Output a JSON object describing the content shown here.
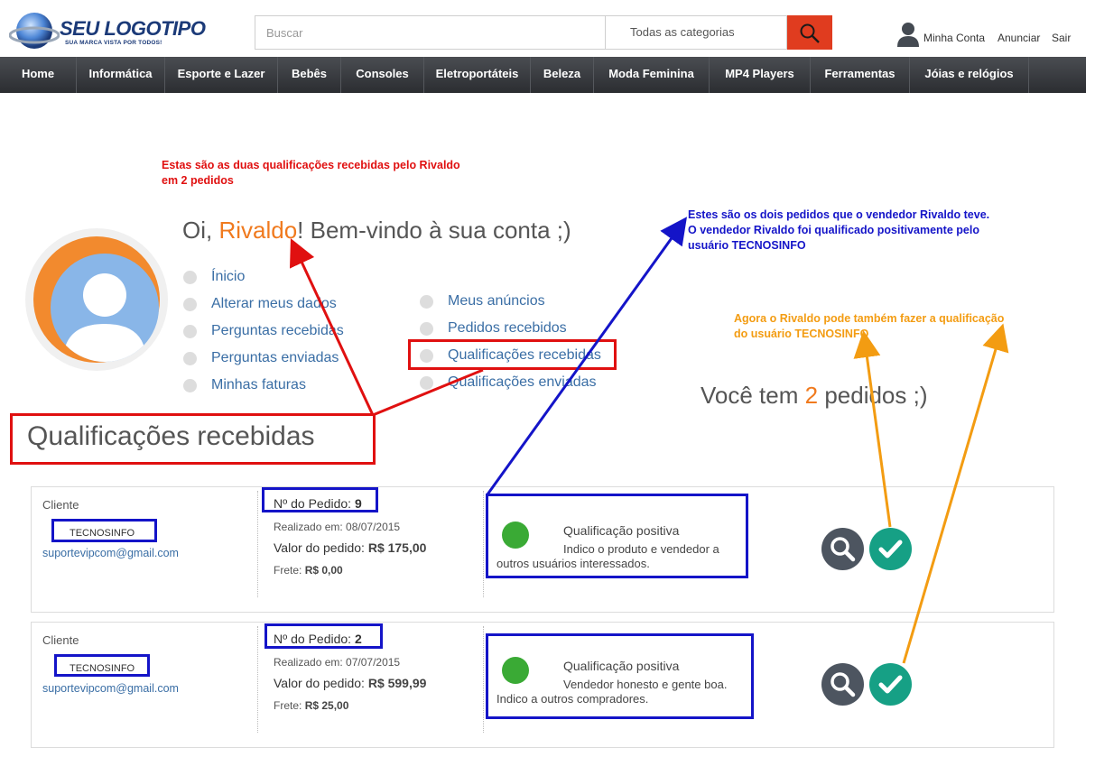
{
  "header": {
    "logo_title": "SEU LOGOTIPO",
    "logo_subtitle": "SUA MARCA VISTA POR TODOS!",
    "search_placeholder": "Buscar",
    "category_label": "Todas as categorias",
    "account_label": "Minha Conta",
    "announce_label": "Anunciar",
    "logout_label": "Sair"
  },
  "nav": [
    "Home",
    "Informática",
    "Esporte e Lazer",
    "Bebês",
    "Consoles",
    "Eletroportáteis",
    "Beleza",
    "Moda Feminina",
    "MP4 Players",
    "Ferramentas",
    "Jóias e relógios"
  ],
  "annotations": {
    "red_line1": "Estas são as duas qualificações recebidas pelo Rivaldo",
    "red_line2": "em 2 pedidos",
    "blue_line1": "Estes são os dois pedidos que o vendedor Rivaldo teve.",
    "blue_line2": "O vendedor Rivaldo foi qualificado positivamente pelo",
    "blue_line3": "usuário TECNOSINFO",
    "orange_line1": "Agora o Rivaldo pode também fazer a qualificação",
    "orange_line2": "do usuário TECNOSINFO"
  },
  "greeting": {
    "prefix": "Oi, ",
    "name": "Rivaldo",
    "suffix": "! Bem-vindo à sua conta ;)"
  },
  "menu_left": [
    "Ínicio",
    "Alterar meus dados",
    "Perguntas recebidas",
    "Perguntas enviadas",
    "Minhas faturas"
  ],
  "menu_right": [
    "Meus anúncios",
    "Pedidos recebidos",
    "Qualificações recebidas",
    "Qualificações enviadas"
  ],
  "orders_summary": {
    "prefix": "Você tem ",
    "count": "2",
    "suffix": " pedidos ;)"
  },
  "section_title": "Qualificações recebidas",
  "orders": [
    {
      "client_label": "Cliente",
      "username": "TECNOSINFO",
      "email": "suportevipcom@gmail.com",
      "order_label": "Nº do Pedido: ",
      "order_number": "9",
      "date_text": "Realizado em: 08/07/2015",
      "value_label": "Valor do pedido: ",
      "value": "R$ 175,00",
      "shipping_label": "Frete: ",
      "shipping": "R$ 0,00",
      "rating_title": "Qualificação positiva",
      "rating_text": "Indico o produto e vendedor a outros usuários interessados."
    },
    {
      "client_label": "Cliente",
      "username": "TECNOSINFO",
      "email": "suportevipcom@gmail.com",
      "order_label": "Nº do Pedido: ",
      "order_number": "2",
      "date_text": "Realizado em: 07/07/2015",
      "value_label": "Valor do pedido: ",
      "value": "R$ 599,99",
      "shipping_label": "Frete: ",
      "shipping": "R$ 25,00",
      "rating_title": "Qualificação positiva",
      "rating_text": "Vendedor honesto e gente boa. Indico a outros compradores."
    }
  ]
}
